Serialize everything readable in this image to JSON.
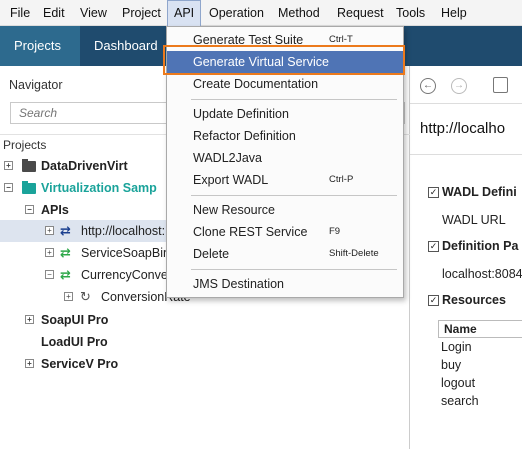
{
  "menubar": {
    "items": [
      "File",
      "Edit",
      "View",
      "Project",
      "API",
      "Operation",
      "Method",
      "Request",
      "Tools",
      "Help"
    ],
    "active": "API"
  },
  "tabs": {
    "projects": "Projects",
    "dashboard": "Dashboard"
  },
  "navigator": {
    "title": "Navigator",
    "search_placeholder": "Search",
    "projects_label": "Projects",
    "tree": {
      "data_driven": "DataDrivenVirt",
      "virtualization": "Virtualization Samp",
      "apis": "APIs",
      "localhost": "http://localhost:",
      "service_soap": "ServiceSoapBin",
      "currency": "CurrencyConve",
      "conversion": "ConversionRate",
      "soapui": "SoapUI Pro",
      "loadui": "LoadUI Pro",
      "servicev": "ServiceV Pro"
    }
  },
  "dropdown": {
    "items": [
      {
        "label": "Generate Test Suite",
        "shortcut": "Ctrl-T"
      },
      {
        "label": "Generate Virtual Service",
        "shortcut": ""
      },
      {
        "label": "Create Documentation",
        "shortcut": ""
      },
      {
        "label": "Update Definition",
        "shortcut": ""
      },
      {
        "label": "Refactor Definition",
        "shortcut": ""
      },
      {
        "label": "WADL2Java",
        "shortcut": ""
      },
      {
        "label": "Export WADL",
        "shortcut": "Ctrl-P"
      },
      {
        "label": "New Resource",
        "shortcut": ""
      },
      {
        "label": "Clone REST Service",
        "shortcut": "F9"
      },
      {
        "label": "Delete",
        "shortcut": "Shift-Delete"
      },
      {
        "label": "JMS Destination",
        "shortcut": ""
      }
    ]
  },
  "right_panel": {
    "url": "http://localho",
    "wadl_section": "WADL Defini",
    "wadl_url_label": "WADL URL",
    "definition_section": "Definition Pa",
    "definition_value": "localhost:8084",
    "resources_section": "Resources",
    "name_header": "Name",
    "resources": [
      "Login",
      "buy",
      "logout",
      "search"
    ]
  },
  "colors": {
    "tab_bar": "#1f4b6e",
    "tab_active": "#2d6a8e",
    "highlight": "#4f74b5",
    "focus_outline": "#ec7a1c",
    "teal": "#1aa39a"
  }
}
